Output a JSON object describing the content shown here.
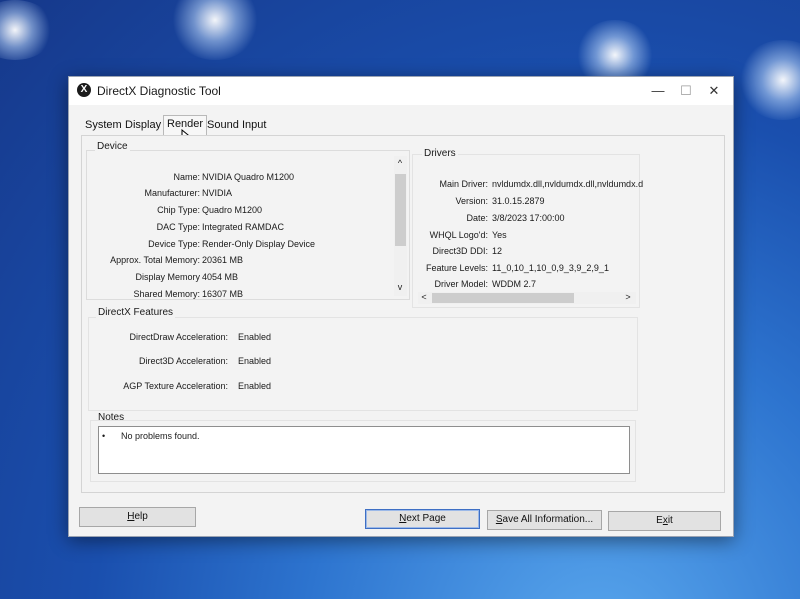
{
  "window": {
    "title": "DirectX Diagnostic Tool",
    "minimize": "—",
    "maximize": "☐",
    "close": "✕",
    "icon_glyph": "X"
  },
  "tabs": [
    {
      "label": "System"
    },
    {
      "label": "Display"
    },
    {
      "label": "Render",
      "active": true
    },
    {
      "label": "Sound"
    },
    {
      "label": "Input"
    }
  ],
  "device": {
    "group_label": "Device",
    "rows": [
      {
        "label": "Name:",
        "value": "NVIDIA Quadro M1200"
      },
      {
        "label": "Manufacturer:",
        "value": "NVIDIA"
      },
      {
        "label": "Chip Type:",
        "value": "Quadro M1200"
      },
      {
        "label": "DAC Type:",
        "value": "Integrated RAMDAC"
      },
      {
        "label": "Device Type:",
        "value": "Render-Only Display Device"
      },
      {
        "label": "Approx. Total Memory:",
        "value": "20361 MB"
      },
      {
        "label": "Display Memory",
        "value": "4054 MB"
      },
      {
        "label": "Shared Memory:",
        "value": "16307 MB"
      }
    ]
  },
  "drivers": {
    "group_label": "Drivers",
    "rows": [
      {
        "label": "Main Driver:",
        "value": "nvldumdx.dll,nvldumdx.dll,nvldumdx.d"
      },
      {
        "label": "Version:",
        "value": "31.0.15.2879"
      },
      {
        "label": "Date:",
        "value": "3/8/2023 17:00:00"
      },
      {
        "label": "WHQL Logo'd:",
        "value": "Yes"
      },
      {
        "label": "Direct3D DDI:",
        "value": "12"
      },
      {
        "label": "Feature Levels:",
        "value": "11_0,10_1,10_0,9_3,9_2,9_1"
      },
      {
        "label": "Driver Model:",
        "value": "WDDM 2.7"
      }
    ]
  },
  "features": {
    "group_label": "DirectX Features",
    "rows": [
      {
        "label": "DirectDraw Acceleration:",
        "value": "Enabled"
      },
      {
        "label": "Direct3D Acceleration:",
        "value": "Enabled"
      },
      {
        "label": "AGP Texture Acceleration:",
        "value": "Enabled"
      }
    ]
  },
  "notes": {
    "group_label": "Notes",
    "bullet": "•",
    "text": "No problems found."
  },
  "buttons": {
    "help": {
      "label": "Help",
      "access": "H",
      "rest": "elp"
    },
    "next": {
      "label": "Next Page",
      "access": "N",
      "rest": "ext Page"
    },
    "save": {
      "label": "Save All Information...",
      "access": "S",
      "rest": "ave All Information..."
    },
    "exit": {
      "label": "Exit",
      "access": "x",
      "pre": "E",
      "rest": "it"
    }
  },
  "scroll": {
    "up": "^",
    "down": "v",
    "left": "<",
    "right": ">"
  },
  "colors": {
    "accent": "#3e6fc4",
    "window_bg": "#f3f3f3",
    "desktop": "#1a4fae"
  }
}
